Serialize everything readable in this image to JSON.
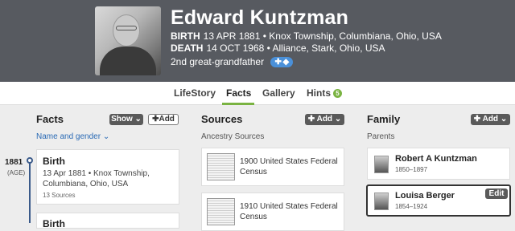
{
  "person": {
    "name": "Edward Kuntzman",
    "birth_label": "BIRTH",
    "birth_value": "13 APR 1881 • Knox Township, Columbiana, Ohio, USA",
    "death_label": "DEATH",
    "death_value": "14 OCT 1968 • Alliance, Stark, Ohio, USA",
    "relationship": "2nd great-grandfather"
  },
  "tabs": [
    {
      "label": "LifeStory"
    },
    {
      "label": "Facts",
      "active": true
    },
    {
      "label": "Gallery"
    },
    {
      "label": "Hints",
      "count": "5"
    }
  ],
  "facts": {
    "title": "Facts",
    "show_label": "Show",
    "add_label": "Add",
    "filter_label": "Name and gender",
    "year": "1881",
    "age": "(AGE)",
    "birth_card": {
      "title": "Birth",
      "detail": "13 Apr 1881 • Knox Township, Columbiana, Ohio, USA",
      "sources": "13 Sources"
    },
    "next_card_title": "Birth"
  },
  "sources": {
    "title": "Sources",
    "add_label": "Add",
    "sub": "Ancestry Sources",
    "items": [
      {
        "label": "1900 United States Federal Census"
      },
      {
        "label": "1910 United States Federal Census"
      }
    ]
  },
  "family": {
    "title": "Family",
    "add_label": "Add",
    "sub": "Parents",
    "members": [
      {
        "name": "Robert A Kuntzman",
        "dates": "1850–1897"
      },
      {
        "name": "Louisa Berger",
        "dates": "1854–1924",
        "edit_label": "Edit"
      }
    ]
  },
  "colors": {
    "accent": "#7ab342",
    "header": "#575a60",
    "link": "#2a6ab5"
  }
}
